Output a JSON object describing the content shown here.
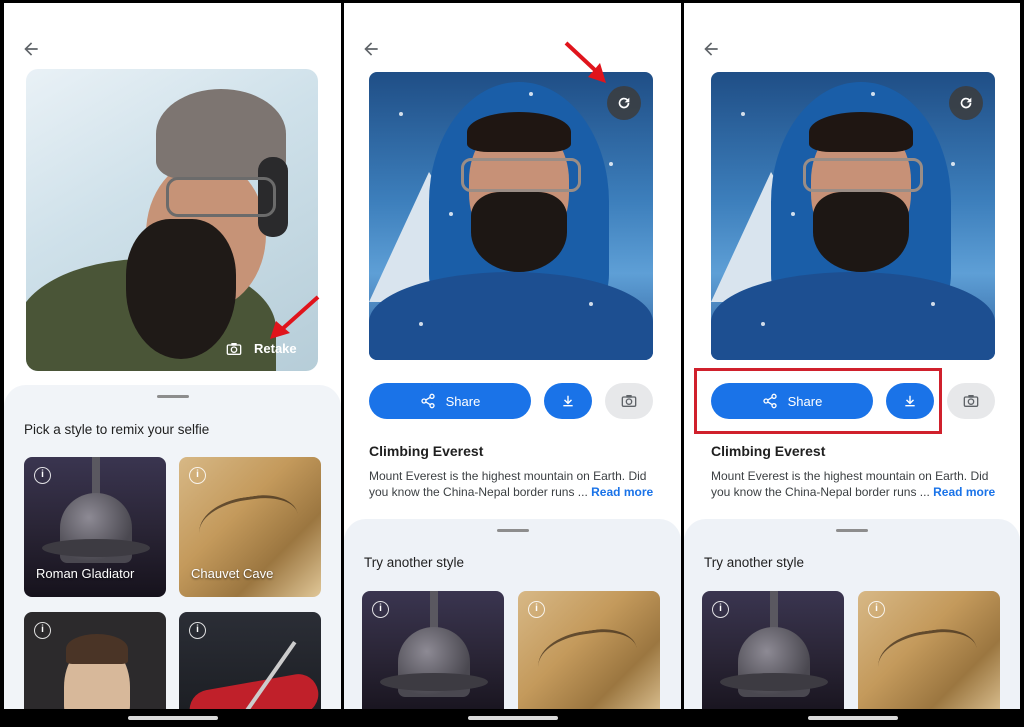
{
  "panel1": {
    "retake_label": "Retake",
    "sheet_title": "Pick a style to remix your selfie",
    "styles": [
      {
        "label": "Roman Gladiator"
      },
      {
        "label": "Chauvet Cave"
      },
      {
        "label": ""
      },
      {
        "label": ""
      }
    ]
  },
  "panel2": {
    "share_label": "Share",
    "style_title": "Climbing Everest",
    "style_desc": "Mount Everest is the highest mountain on Earth. Did you know the China-Nepal border runs ...",
    "read_more": "Read more",
    "sheet_title": "Try another style"
  },
  "panel3": {
    "share_label": "Share",
    "style_title": "Climbing Everest",
    "style_desc": "Mount Everest is the highest mountain on Earth. Did you know the China-Nepal border runs ...",
    "read_more": "Read more",
    "sheet_title": "Try another style"
  },
  "icons": {
    "info_glyph": "i"
  },
  "colors": {
    "accent": "#1a73e8",
    "annotation_red": "#d0202c"
  }
}
